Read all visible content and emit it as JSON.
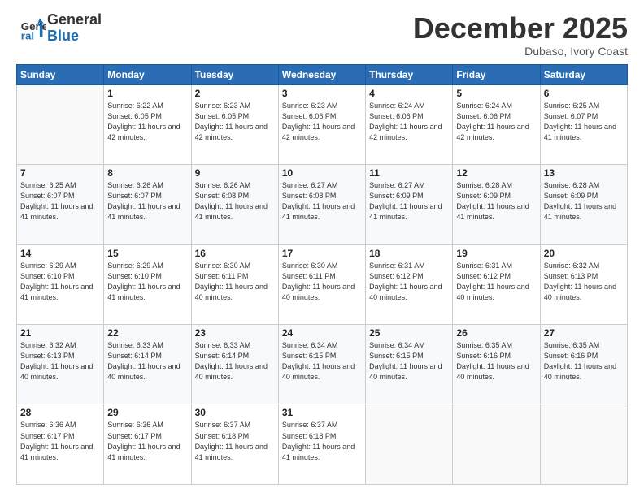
{
  "header": {
    "logo_line1": "General",
    "logo_line2": "Blue",
    "month": "December 2025",
    "location": "Dubaso, Ivory Coast"
  },
  "weekdays": [
    "Sunday",
    "Monday",
    "Tuesday",
    "Wednesday",
    "Thursday",
    "Friday",
    "Saturday"
  ],
  "weeks": [
    [
      {
        "day": "",
        "sunrise": "",
        "sunset": "",
        "daylight": ""
      },
      {
        "day": "1",
        "sunrise": "Sunrise: 6:22 AM",
        "sunset": "Sunset: 6:05 PM",
        "daylight": "Daylight: 11 hours and 42 minutes."
      },
      {
        "day": "2",
        "sunrise": "Sunrise: 6:23 AM",
        "sunset": "Sunset: 6:05 PM",
        "daylight": "Daylight: 11 hours and 42 minutes."
      },
      {
        "day": "3",
        "sunrise": "Sunrise: 6:23 AM",
        "sunset": "Sunset: 6:06 PM",
        "daylight": "Daylight: 11 hours and 42 minutes."
      },
      {
        "day": "4",
        "sunrise": "Sunrise: 6:24 AM",
        "sunset": "Sunset: 6:06 PM",
        "daylight": "Daylight: 11 hours and 42 minutes."
      },
      {
        "day": "5",
        "sunrise": "Sunrise: 6:24 AM",
        "sunset": "Sunset: 6:06 PM",
        "daylight": "Daylight: 11 hours and 42 minutes."
      },
      {
        "day": "6",
        "sunrise": "Sunrise: 6:25 AM",
        "sunset": "Sunset: 6:07 PM",
        "daylight": "Daylight: 11 hours and 41 minutes."
      }
    ],
    [
      {
        "day": "7",
        "sunrise": "Sunrise: 6:25 AM",
        "sunset": "Sunset: 6:07 PM",
        "daylight": "Daylight: 11 hours and 41 minutes."
      },
      {
        "day": "8",
        "sunrise": "Sunrise: 6:26 AM",
        "sunset": "Sunset: 6:07 PM",
        "daylight": "Daylight: 11 hours and 41 minutes."
      },
      {
        "day": "9",
        "sunrise": "Sunrise: 6:26 AM",
        "sunset": "Sunset: 6:08 PM",
        "daylight": "Daylight: 11 hours and 41 minutes."
      },
      {
        "day": "10",
        "sunrise": "Sunrise: 6:27 AM",
        "sunset": "Sunset: 6:08 PM",
        "daylight": "Daylight: 11 hours and 41 minutes."
      },
      {
        "day": "11",
        "sunrise": "Sunrise: 6:27 AM",
        "sunset": "Sunset: 6:09 PM",
        "daylight": "Daylight: 11 hours and 41 minutes."
      },
      {
        "day": "12",
        "sunrise": "Sunrise: 6:28 AM",
        "sunset": "Sunset: 6:09 PM",
        "daylight": "Daylight: 11 hours and 41 minutes."
      },
      {
        "day": "13",
        "sunrise": "Sunrise: 6:28 AM",
        "sunset": "Sunset: 6:09 PM",
        "daylight": "Daylight: 11 hours and 41 minutes."
      }
    ],
    [
      {
        "day": "14",
        "sunrise": "Sunrise: 6:29 AM",
        "sunset": "Sunset: 6:10 PM",
        "daylight": "Daylight: 11 hours and 41 minutes."
      },
      {
        "day": "15",
        "sunrise": "Sunrise: 6:29 AM",
        "sunset": "Sunset: 6:10 PM",
        "daylight": "Daylight: 11 hours and 41 minutes."
      },
      {
        "day": "16",
        "sunrise": "Sunrise: 6:30 AM",
        "sunset": "Sunset: 6:11 PM",
        "daylight": "Daylight: 11 hours and 40 minutes."
      },
      {
        "day": "17",
        "sunrise": "Sunrise: 6:30 AM",
        "sunset": "Sunset: 6:11 PM",
        "daylight": "Daylight: 11 hours and 40 minutes."
      },
      {
        "day": "18",
        "sunrise": "Sunrise: 6:31 AM",
        "sunset": "Sunset: 6:12 PM",
        "daylight": "Daylight: 11 hours and 40 minutes."
      },
      {
        "day": "19",
        "sunrise": "Sunrise: 6:31 AM",
        "sunset": "Sunset: 6:12 PM",
        "daylight": "Daylight: 11 hours and 40 minutes."
      },
      {
        "day": "20",
        "sunrise": "Sunrise: 6:32 AM",
        "sunset": "Sunset: 6:13 PM",
        "daylight": "Daylight: 11 hours and 40 minutes."
      }
    ],
    [
      {
        "day": "21",
        "sunrise": "Sunrise: 6:32 AM",
        "sunset": "Sunset: 6:13 PM",
        "daylight": "Daylight: 11 hours and 40 minutes."
      },
      {
        "day": "22",
        "sunrise": "Sunrise: 6:33 AM",
        "sunset": "Sunset: 6:14 PM",
        "daylight": "Daylight: 11 hours and 40 minutes."
      },
      {
        "day": "23",
        "sunrise": "Sunrise: 6:33 AM",
        "sunset": "Sunset: 6:14 PM",
        "daylight": "Daylight: 11 hours and 40 minutes."
      },
      {
        "day": "24",
        "sunrise": "Sunrise: 6:34 AM",
        "sunset": "Sunset: 6:15 PM",
        "daylight": "Daylight: 11 hours and 40 minutes."
      },
      {
        "day": "25",
        "sunrise": "Sunrise: 6:34 AM",
        "sunset": "Sunset: 6:15 PM",
        "daylight": "Daylight: 11 hours and 40 minutes."
      },
      {
        "day": "26",
        "sunrise": "Sunrise: 6:35 AM",
        "sunset": "Sunset: 6:16 PM",
        "daylight": "Daylight: 11 hours and 40 minutes."
      },
      {
        "day": "27",
        "sunrise": "Sunrise: 6:35 AM",
        "sunset": "Sunset: 6:16 PM",
        "daylight": "Daylight: 11 hours and 40 minutes."
      }
    ],
    [
      {
        "day": "28",
        "sunrise": "Sunrise: 6:36 AM",
        "sunset": "Sunset: 6:17 PM",
        "daylight": "Daylight: 11 hours and 41 minutes."
      },
      {
        "day": "29",
        "sunrise": "Sunrise: 6:36 AM",
        "sunset": "Sunset: 6:17 PM",
        "daylight": "Daylight: 11 hours and 41 minutes."
      },
      {
        "day": "30",
        "sunrise": "Sunrise: 6:37 AM",
        "sunset": "Sunset: 6:18 PM",
        "daylight": "Daylight: 11 hours and 41 minutes."
      },
      {
        "day": "31",
        "sunrise": "Sunrise: 6:37 AM",
        "sunset": "Sunset: 6:18 PM",
        "daylight": "Daylight: 11 hours and 41 minutes."
      },
      {
        "day": "",
        "sunrise": "",
        "sunset": "",
        "daylight": ""
      },
      {
        "day": "",
        "sunrise": "",
        "sunset": "",
        "daylight": ""
      },
      {
        "day": "",
        "sunrise": "",
        "sunset": "",
        "daylight": ""
      }
    ]
  ]
}
